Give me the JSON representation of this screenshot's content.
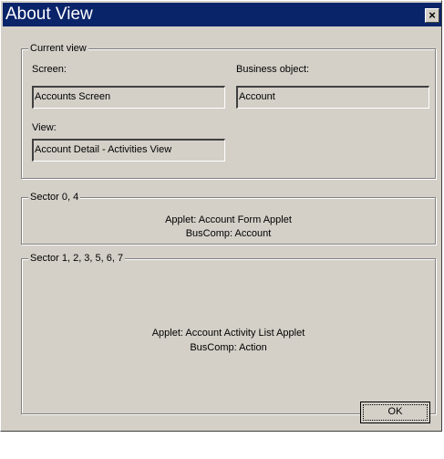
{
  "window": {
    "title": "About View",
    "close_glyph": "×"
  },
  "current_view": {
    "legend": "Current view",
    "screen_label": "Screen:",
    "screen_value": "Accounts Screen",
    "business_object_label": "Business object:",
    "business_object_value": "Account",
    "view_label": "View:",
    "view_value": "Account Detail - Activities View"
  },
  "sectors": [
    {
      "legend": "Sector 0, 4",
      "applet": "Applet: Account Form Applet",
      "buscomp": "BusComp: Account"
    },
    {
      "legend": "Sector 1, 2, 3, 5, 6, 7",
      "applet": "Applet: Account Activity List Applet",
      "buscomp": "BusComp: Action"
    }
  ],
  "buttons": {
    "ok_label": "OK"
  },
  "colors": {
    "titlebar": "#0a246a",
    "dialog_face": "#d4d0c8"
  }
}
